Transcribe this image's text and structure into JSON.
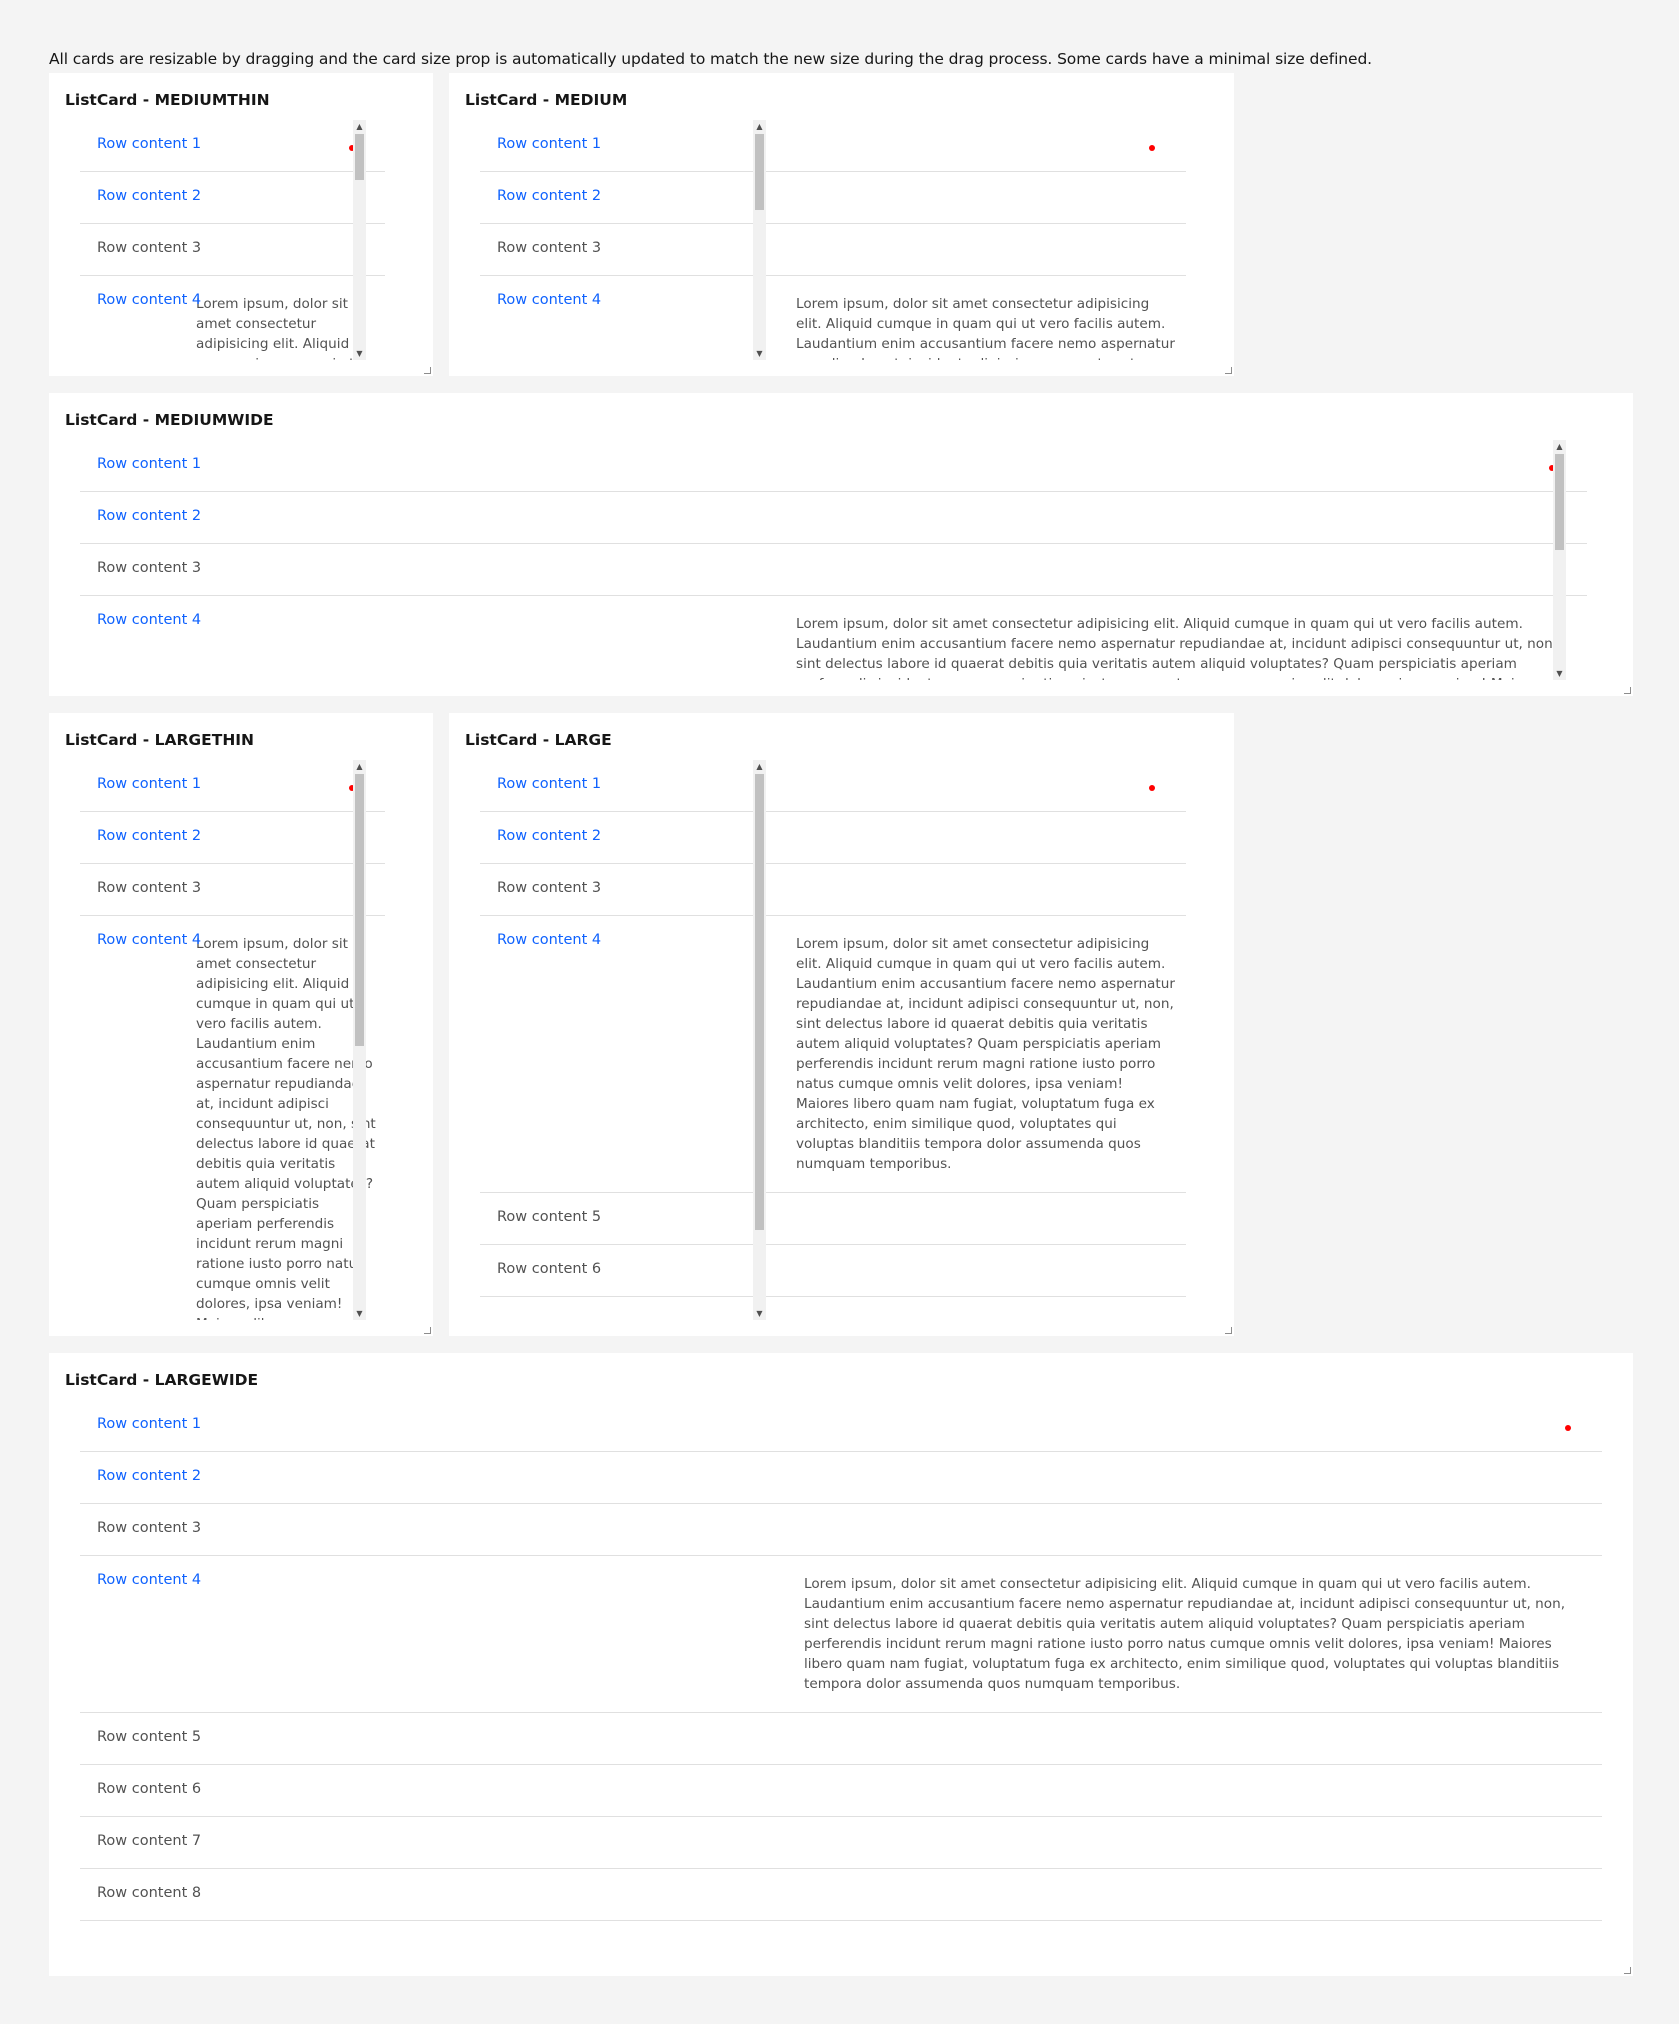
{
  "description": "All cards are resizable by dragging and the card size prop is automatically updated to match the new size during the drag process. Some cards have a minimal size defined.",
  "lorem": "Lorem ipsum, dolor sit amet consectetur adipisicing elit. Aliquid cumque in quam qui ut vero facilis autem. Laudantium enim accusantium facere nemo aspernatur repudiandae at, incidunt adipisci consequuntur ut, non, sint delectus labore id quaerat debitis quia veritatis autem aliquid voluptates? Quam perspiciatis aperiam perferendis incidunt rerum magni ratione iusto porro natus cumque omnis velit dolores, ipsa veniam! Maiores libero quam nam fugiat, voluptatum fuga ex architecto, enim similique quod, voluptates qui voluptas blanditiis tempora dolor assumenda quos numquam temporibus.",
  "colors": {
    "link": "#0f62fe",
    "dot": "#ff0000",
    "text": "#525252",
    "background": "#f4f4f4"
  },
  "cards": [
    {
      "key": "mediumthin",
      "title": "ListCard - MEDIUMTHIN",
      "rows": [
        {
          "label": "Row content 1",
          "link": true
        },
        {
          "label": "Row content 2",
          "link": true
        },
        {
          "label": "Row content 3",
          "link": false
        },
        {
          "label": "Row content 4",
          "link": true
        }
      ]
    },
    {
      "key": "medium",
      "title": "ListCard - MEDIUM",
      "rows": [
        {
          "label": "Row content 1",
          "link": true
        },
        {
          "label": "Row content 2",
          "link": true
        },
        {
          "label": "Row content 3",
          "link": false
        },
        {
          "label": "Row content 4",
          "link": true
        }
      ]
    },
    {
      "key": "mediumwide",
      "title": "ListCard - MEDIUMWIDE",
      "rows": [
        {
          "label": "Row content 1",
          "link": true
        },
        {
          "label": "Row content 2",
          "link": true
        },
        {
          "label": "Row content 3",
          "link": false
        },
        {
          "label": "Row content 4",
          "link": true
        }
      ]
    },
    {
      "key": "largethin",
      "title": "ListCard - LARGETHIN",
      "rows": [
        {
          "label": "Row content 1",
          "link": true
        },
        {
          "label": "Row content 2",
          "link": true
        },
        {
          "label": "Row content 3",
          "link": false
        },
        {
          "label": "Row content 4",
          "link": true
        }
      ]
    },
    {
      "key": "large",
      "title": "ListCard - LARGE",
      "rows": [
        {
          "label": "Row content 1",
          "link": true
        },
        {
          "label": "Row content 2",
          "link": true
        },
        {
          "label": "Row content 3",
          "link": false
        },
        {
          "label": "Row content 4",
          "link": true
        },
        {
          "label": "Row content 5",
          "link": false
        },
        {
          "label": "Row content 6",
          "link": false
        }
      ]
    },
    {
      "key": "largewide",
      "title": "ListCard - LARGEWIDE",
      "rows": [
        {
          "label": "Row content 1",
          "link": true
        },
        {
          "label": "Row content 2",
          "link": true
        },
        {
          "label": "Row content 3",
          "link": false
        },
        {
          "label": "Row content 4",
          "link": true
        },
        {
          "label": "Row content 5",
          "link": false
        },
        {
          "label": "Row content 6",
          "link": false
        },
        {
          "label": "Row content 7",
          "link": false
        },
        {
          "label": "Row content 8",
          "link": false
        }
      ]
    }
  ]
}
